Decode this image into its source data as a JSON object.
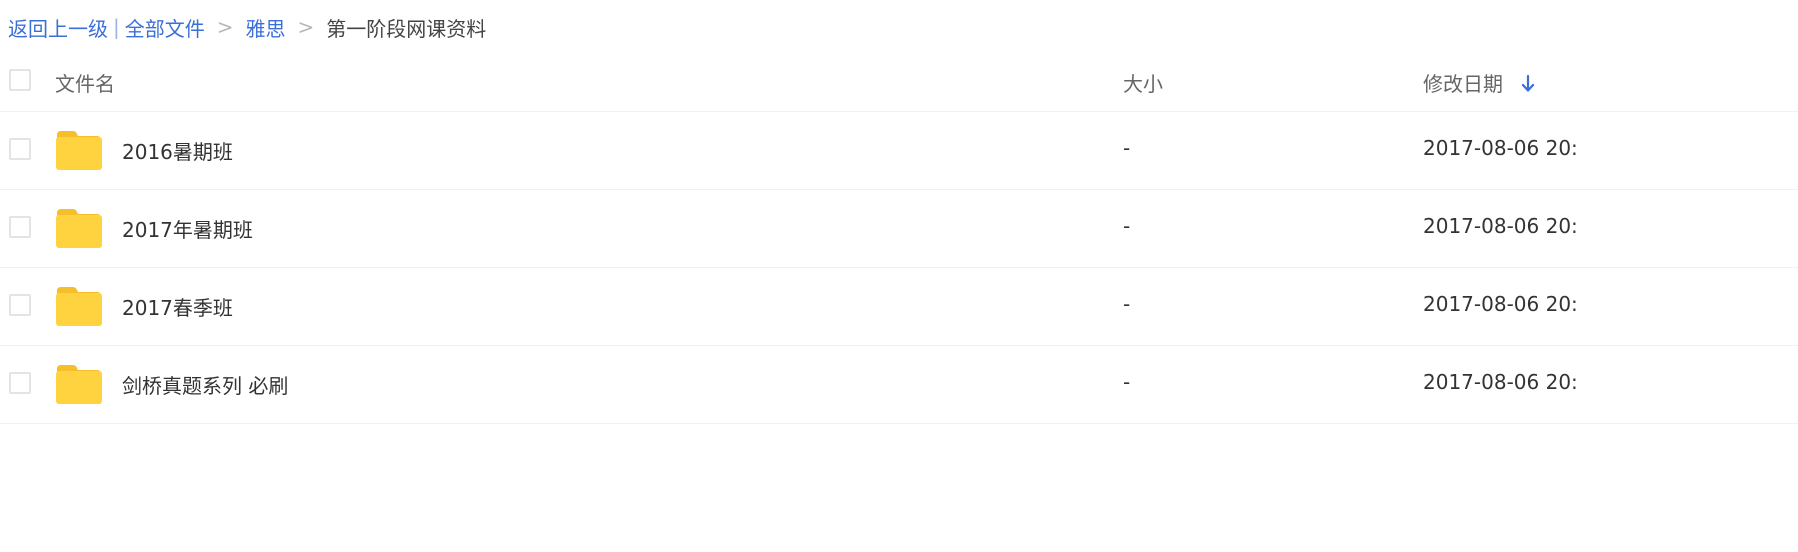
{
  "breadcrumb": {
    "back": "返回上一级",
    "pipe": "|",
    "root": "全部文件",
    "sep": ">",
    "level1": "雅思",
    "current": "第一阶段网课资料"
  },
  "table": {
    "headers": {
      "name": "文件名",
      "size": "大小",
      "date": "修改日期"
    },
    "sort_icon": "arrow-down-icon",
    "folder_icon": "folder-icon",
    "rows": [
      {
        "name": "2016暑期班",
        "size": "-",
        "date": "2017-08-06 20:"
      },
      {
        "name": "2017年暑期班",
        "size": "-",
        "date": "2017-08-06 20:"
      },
      {
        "name": "2017春季班",
        "size": "-",
        "date": "2017-08-06 20:"
      },
      {
        "name": "剑桥真题系列 必刷",
        "size": "-",
        "date": "2017-08-06 20:"
      }
    ]
  },
  "colors": {
    "link": "#3b6fd8",
    "folder": "#ffd23f",
    "folder_tab": "#f5bf2a",
    "sort_arrow": "#3b6fd8"
  }
}
